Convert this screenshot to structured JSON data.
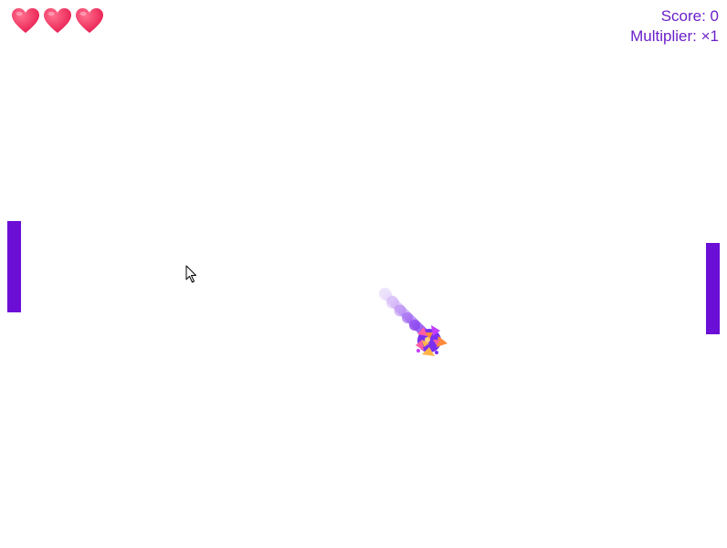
{
  "lives": {
    "count": 3,
    "icon": "heart-icon",
    "color": "#f0305e"
  },
  "hud": {
    "score_label": "Score: 0",
    "multiplier_label": "Multiplier: ×1",
    "color": "#6a1fc9"
  },
  "paddles": {
    "color": "#6b0fd6"
  },
  "ball": {
    "trail_color": "#8a3de8",
    "particle_colors": [
      "#ff5fa2",
      "#ff8a3d",
      "#7a2ff0",
      "#ffb347",
      "#c13cff"
    ]
  }
}
